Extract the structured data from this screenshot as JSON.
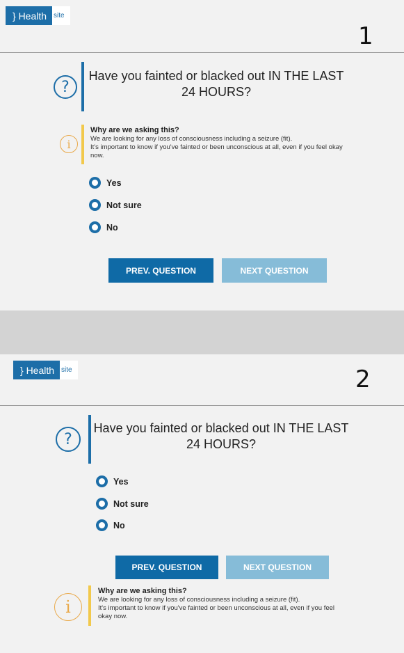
{
  "logo": {
    "brand": "} Health",
    "suffix": "site"
  },
  "panels": [
    {
      "number": "1",
      "question": "Have you fainted or blacked out IN THE LAST 24 HOURS?",
      "info_title": "Why are we asking this?",
      "info_line1": "We are looking for any loss of consciousness including a seizure (fit).",
      "info_line2": "It's important to know if you've fainted or been unconscious at all, even if you feel okay now.",
      "options": [
        "Yes",
        "Not sure",
        "No"
      ],
      "prev_label": "PREV. QUESTION",
      "next_label": "NEXT QUESTION"
    },
    {
      "number": "2",
      "question": "Have you fainted or blacked out IN THE LAST 24 HOURS?",
      "info_title": "Why are we asking this?",
      "info_line1": "We are looking for any loss of consciousness including a seizure (fit).",
      "info_line2": "It's important to know if you've fainted or been unconscious at all, even if you feel okay now.",
      "options": [
        "Yes",
        "Not sure",
        "No"
      ],
      "prev_label": "PREV. QUESTION",
      "next_label": "NEXT QUESTION"
    }
  ],
  "icons": {
    "question": "question-mark-icon",
    "info": "info-icon"
  },
  "colors": {
    "brand_blue": "#1d6ea8",
    "button_prev": "#0f6aa6",
    "button_next_disabled": "#86bcd8",
    "info_accent": "#f2c94c"
  }
}
